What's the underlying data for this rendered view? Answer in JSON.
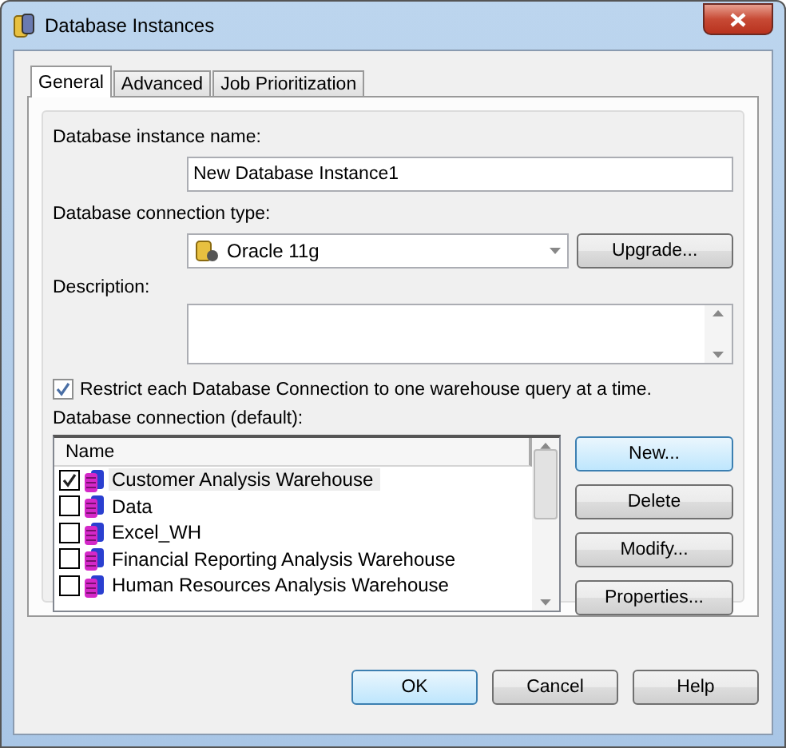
{
  "window": {
    "title": "Database Instances"
  },
  "tabs": [
    {
      "label": "General",
      "selected": true
    },
    {
      "label": "Advanced",
      "selected": false
    },
    {
      "label": "Job Prioritization",
      "selected": false
    }
  ],
  "instance_name": {
    "label": "Database instance name:",
    "value": "New Database Instance1"
  },
  "connection_type": {
    "label": "Database connection type:",
    "value": "Oracle 11g",
    "button": "Upgrade..."
  },
  "description": {
    "label": "Description:"
  },
  "restrict": {
    "label": "Restrict each Database Connection to one warehouse query at a time.",
    "checked": true
  },
  "connections": {
    "label": "Database connection (default):",
    "column": "Name",
    "rows": [
      {
        "name": "Customer Analysis Warehouse",
        "checked": true,
        "selected": true
      },
      {
        "name": "Data",
        "checked": false,
        "selected": false
      },
      {
        "name": "Excel_WH",
        "checked": false,
        "selected": false
      },
      {
        "name": "Financial Reporting Analysis Warehouse",
        "checked": false,
        "selected": false
      },
      {
        "name": "Human Resources Analysis Warehouse",
        "checked": false,
        "selected": false
      }
    ],
    "buttons": [
      "New...",
      "Delete",
      "Modify...",
      "Properties..."
    ]
  },
  "buttons": [
    "OK",
    "Cancel",
    "Help"
  ]
}
